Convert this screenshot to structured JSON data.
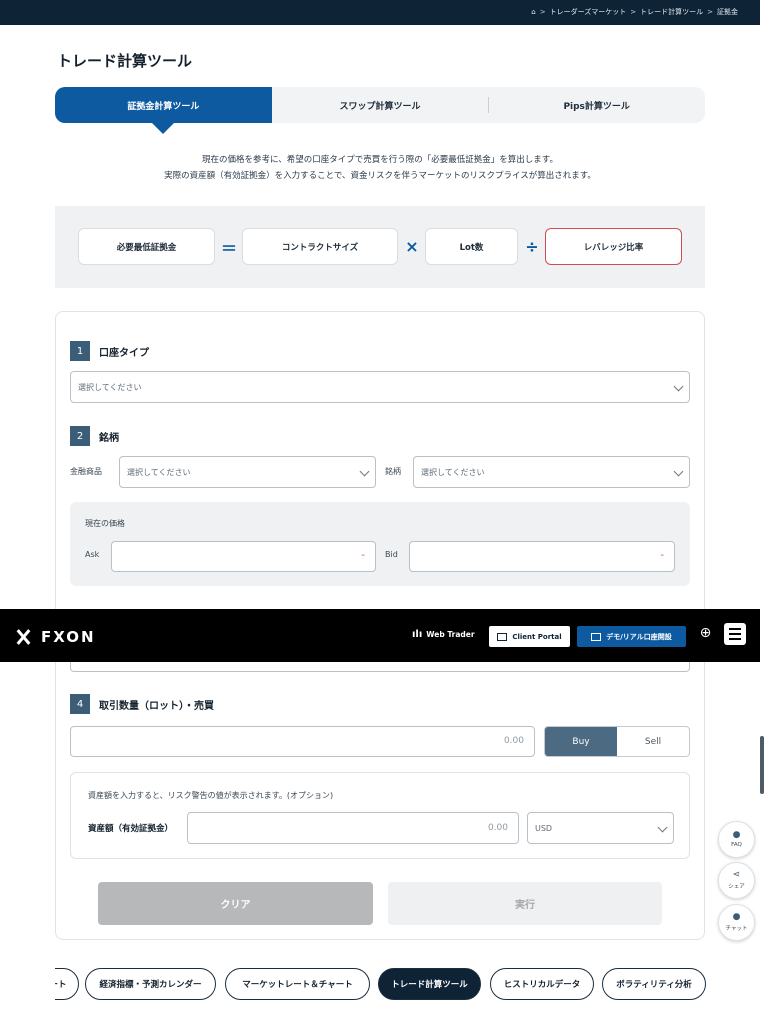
{
  "breadcrumb": {
    "home": "⌂",
    "items": [
      "トレーダーズマーケット",
      "トレード計算ツール",
      "証拠金"
    ],
    "sep": ">"
  },
  "page_title": "トレード計算ツール",
  "tabs": [
    {
      "label": "証拠金計算ツール",
      "active": true
    },
    {
      "label": "スワップ計算ツール",
      "active": false
    },
    {
      "label": "Pips計算ツール",
      "active": false
    }
  ],
  "intro": {
    "line1": "現在の価格を参考に、希望の口座タイプで売買を行う際の「必要最低証拠金」を算出します。",
    "line2": "実際の資産額（有効証拠金）を入力することで、資金リスクを伴うマーケットのリスクプライスが算出されます。"
  },
  "formula": {
    "result": "必要最低証拠金",
    "eq": "＝",
    "contract": "コントラクトサイズ",
    "times": "×",
    "lot": "Lot数",
    "div": "÷",
    "leverage": "レバレッジ比率"
  },
  "step1": {
    "num": "1",
    "title": "口座タイプ",
    "select": "選択してください"
  },
  "step2": {
    "num": "2",
    "title": "銘柄",
    "product_label": "金融商品",
    "product_select": "選択してください",
    "symbol_label": "銘柄",
    "symbol_select": "選択してください",
    "price_title": "現在の価格",
    "ask_label": "Ask",
    "ask_value": "-",
    "bid_label": "Bid",
    "bid_value": "-"
  },
  "navbar": {
    "logo": "FXON",
    "web_trader": "Web Trader",
    "client_portal": "Client Portal",
    "demo_button": "デモ/リアル口座開設"
  },
  "step4": {
    "num": "4",
    "title": "取引数量（ロット）・売買",
    "qty_value": "0.00",
    "buy": "Buy",
    "sell": "Sell",
    "note": "資産額を入力すると、リスク警告の値が表示されます。(オプション)",
    "asset_label": "資産額（有効証拠金）",
    "asset_value": "0.00",
    "currency": "USD"
  },
  "actions": {
    "clear": "クリア",
    "execute": "実行"
  },
  "floating": {
    "faq": "FAQ",
    "share": "シェア",
    "chat": "チャット"
  },
  "bottom_nav": [
    {
      "label": "ート",
      "active": false
    },
    {
      "label": "経済指標・予測カレンダー",
      "active": false
    },
    {
      "label": "マーケットレート＆チャート",
      "active": false
    },
    {
      "label": "トレード計算ツール",
      "active": true
    },
    {
      "label": "ヒストリカルデータ",
      "active": false
    },
    {
      "label": "ボラティリティ分析",
      "active": false
    }
  ]
}
